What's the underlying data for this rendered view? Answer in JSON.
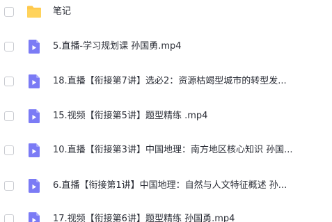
{
  "files": [
    {
      "name": "笔记",
      "icon": "folder-icon",
      "type": "folder"
    },
    {
      "name": "5.直播-学习规划课 孙国勇.mp4",
      "icon": "video-icon",
      "type": "video"
    },
    {
      "name": "18.直播【衔接第7讲】选必2：资源枯竭型城市的转型发...",
      "icon": "video-icon",
      "type": "video"
    },
    {
      "name": "15.视频【衔接第5讲】题型精练 .mp4",
      "icon": "video-icon",
      "type": "video"
    },
    {
      "name": "10.直播【衔接第3讲】中国地理：南方地区核心知识 孙国...",
      "icon": "video-icon",
      "type": "video"
    },
    {
      "name": "6.直播【衔接第1讲】中国地理：自然与人文特征概述 孙...",
      "icon": "video-icon",
      "type": "video"
    },
    {
      "name": "17.视频【衔接第6讲】题型精练 孙国勇.mp4",
      "icon": "video-icon",
      "type": "video"
    }
  ],
  "colors": {
    "folder": "#FFC94D",
    "video": "#7B7BF5",
    "text": "#2a2d36",
    "checkbox_border": "#c8cad0"
  }
}
